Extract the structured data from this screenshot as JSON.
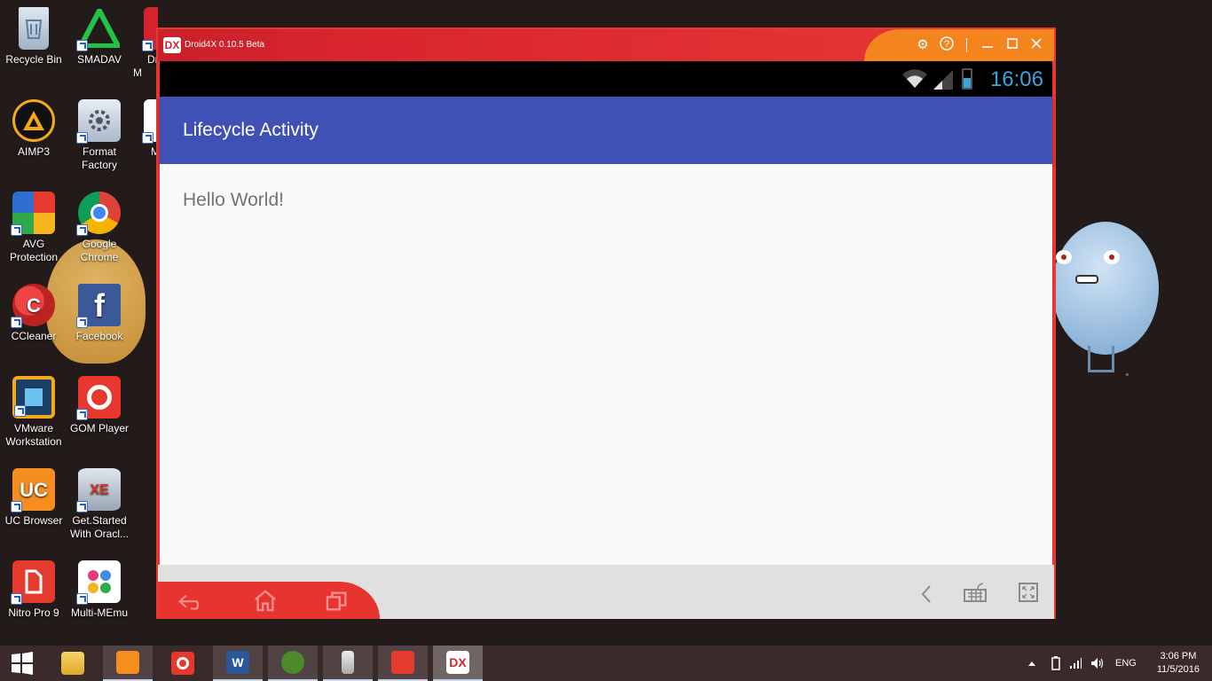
{
  "desktop": {
    "icons": [
      {
        "label": "Recycle Bin",
        "icon": "recycle-bin-icon"
      },
      {
        "label": "SMADAV",
        "icon": "smadav-icon"
      },
      {
        "label": "Dr M",
        "icon": "droid4x-multi-icon"
      },
      {
        "label": "AIMP3",
        "icon": "aimp-icon"
      },
      {
        "label": "Format Factory",
        "icon": "format-factory-icon"
      },
      {
        "label": "M",
        "icon": "m-app-icon"
      },
      {
        "label": "AVG Protection",
        "icon": "avg-icon"
      },
      {
        "label": "Google Chrome",
        "icon": "chrome-icon"
      },
      {
        "label": "CCleaner",
        "icon": "ccleaner-icon"
      },
      {
        "label": "Facebook",
        "icon": "facebook-icon"
      },
      {
        "label": "VMware Workstation",
        "icon": "vmware-icon"
      },
      {
        "label": "GOM Player",
        "icon": "gom-player-icon"
      },
      {
        "label": "UC Browser",
        "icon": "uc-browser-icon"
      },
      {
        "label": "Get.Started With Oracl...",
        "icon": "oracle-icon"
      },
      {
        "label": "Nitro Pro 9",
        "icon": "nitro-icon"
      },
      {
        "label": "Multi-MEmu",
        "icon": "memu-icon"
      }
    ]
  },
  "emulator": {
    "window_title": "Droid4X 0.10.5 Beta",
    "logo_text": "DX",
    "status_time": "16:06",
    "app_title": "Lifecycle Activity",
    "content_text": "Hello World!"
  },
  "taskbar": {
    "language": "ENG",
    "time": "3:06 PM",
    "date": "11/5/2016",
    "items": [
      {
        "icon": "file-explorer-icon"
      },
      {
        "icon": "uc-browser-icon"
      },
      {
        "icon": "gom-player-icon"
      },
      {
        "icon": "word-icon",
        "text": "W"
      },
      {
        "icon": "android-studio-icon"
      },
      {
        "icon": "generic-app-icon"
      },
      {
        "icon": "nitro-icon"
      },
      {
        "icon": "droid4x-icon"
      }
    ]
  },
  "colors": {
    "appbar": "#3f51b5",
    "window_red": "#e8342f",
    "window_orange": "#f4841d",
    "clock_blue": "#3aa4dc"
  }
}
